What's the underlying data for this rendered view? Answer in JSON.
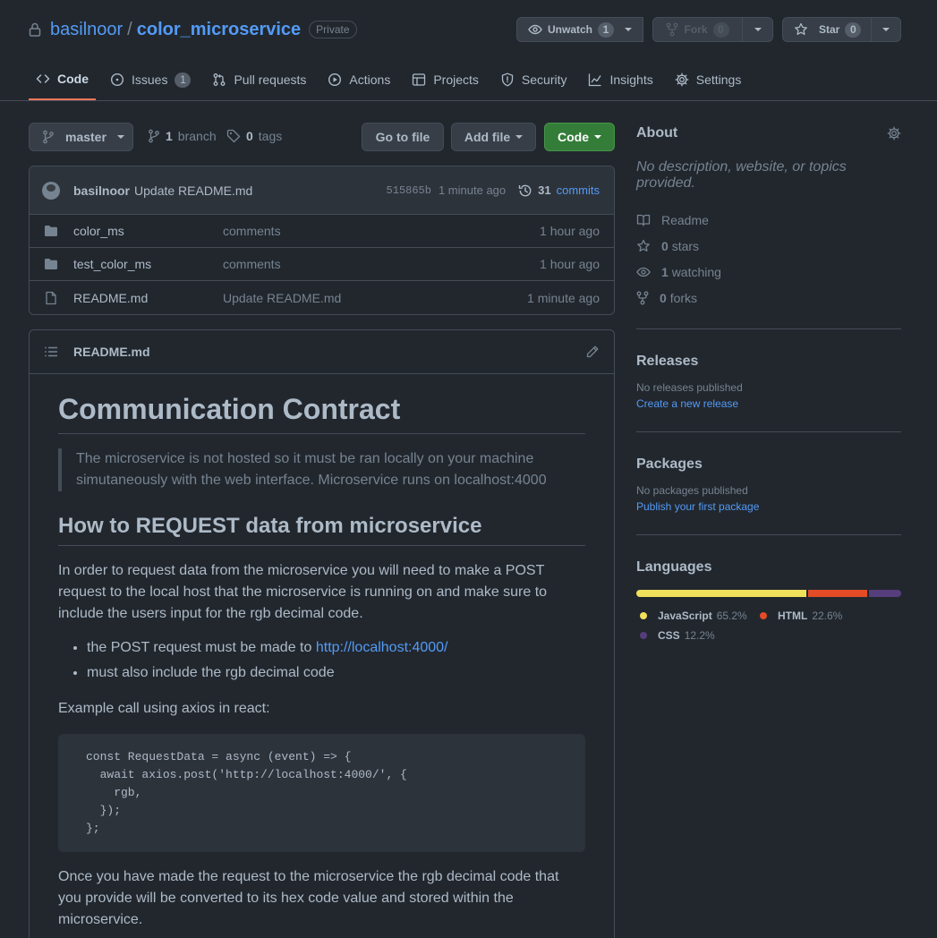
{
  "repo": {
    "owner": "basilnoor",
    "separator": "/",
    "name": "color_microservice",
    "visibility": "Private"
  },
  "header_buttons": {
    "unwatch_label": "Unwatch",
    "unwatch_count": "1",
    "fork_label": "Fork",
    "fork_count": "0",
    "star_label": "Star",
    "star_count": "0"
  },
  "tabs": [
    {
      "label": "Code",
      "icon": "code-icon"
    },
    {
      "label": "Issues",
      "icon": "issue-opened-icon",
      "count": "1"
    },
    {
      "label": "Pull requests",
      "icon": "git-pull-request-icon"
    },
    {
      "label": "Actions",
      "icon": "play-icon"
    },
    {
      "label": "Projects",
      "icon": "table-icon"
    },
    {
      "label": "Security",
      "icon": "shield-icon"
    },
    {
      "label": "Insights",
      "icon": "graph-icon"
    },
    {
      "label": "Settings",
      "icon": "gear-icon"
    }
  ],
  "branchbar": {
    "branch": "master",
    "branch_count": "1",
    "branch_word": "branch",
    "tag_count": "0",
    "tag_word": "tags",
    "goto_file": "Go to file",
    "add_file": "Add file",
    "code": "Code"
  },
  "latest_commit": {
    "author": "basilnoor",
    "message": "Update README.md",
    "sha": "515865b",
    "age": "1 minute ago",
    "commit_count": "31",
    "commit_word": "commits"
  },
  "files": [
    {
      "type": "folder",
      "name": "color_ms",
      "commit": "comments",
      "age": "1 hour ago"
    },
    {
      "type": "folder",
      "name": "test_color_ms",
      "commit": "comments",
      "age": "1 hour ago"
    },
    {
      "type": "file",
      "name": "README.md",
      "commit": "Update README.md",
      "age": "1 minute ago"
    }
  ],
  "readme": {
    "filename": "README.md",
    "h1": "Communication Contract",
    "quote_line1": "The microservice is not hosted so it must be ran locally on your machine",
    "quote_line2": "simutaneously with the web interface. Microservice runs on localhost:4000",
    "h2": "How to REQUEST data from microservice",
    "p1_line1": "In order to request data from the microservice you will need to make a POST",
    "p1_line2": "request to the local host that the microservice is running on and make sure to",
    "p1_line3": "include the users input for the rgb decimal code.",
    "bullet1_text": "the POST request must be made to ",
    "bullet1_link": "http://localhost:4000/",
    "bullet2_text": "must also include the rgb decimal code",
    "p2": "Example call using axios in react:",
    "code": "const RequestData = async (event) => {\n  await axios.post('http://localhost:4000/', {\n    rgb,\n  });\n};",
    "p3_line1": "Once you have made the request to the microservice the rgb decimal code that",
    "p3_line2": "you provide will be converted to its hex code value and stored within the",
    "p3_line3": "microservice."
  },
  "about": {
    "title": "About",
    "description": "No description, website, or topics provided.",
    "readme_label": "Readme",
    "stars_count": "0",
    "stars_word": "stars",
    "watching_count": "1",
    "watching_word": "watching",
    "forks_count": "0",
    "forks_word": "forks"
  },
  "releases": {
    "title": "Releases",
    "empty": "No releases published",
    "link": "Create a new release"
  },
  "packages": {
    "title": "Packages",
    "empty": "No packages published",
    "link": "Publish your first package"
  },
  "languages": {
    "title": "Languages",
    "items": [
      {
        "name": "JavaScript",
        "percent": "65.2%",
        "value": 65.2,
        "color": "#f1e05a"
      },
      {
        "name": "HTML",
        "percent": "22.6%",
        "value": 22.6,
        "color": "#e34c26"
      },
      {
        "name": "CSS",
        "percent": "12.2%",
        "value": 12.2,
        "color": "#563d7c"
      }
    ]
  },
  "colors": {
    "background": "#22272e",
    "accent_link": "#539bf5",
    "active_tab_underline": "#ec775c",
    "code_button": "#347d39"
  }
}
